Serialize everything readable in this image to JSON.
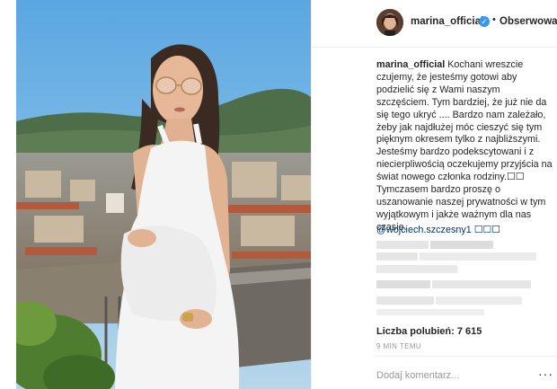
{
  "post": {
    "username": "marina_official",
    "follow_label": "Obserwowanie",
    "caption_user": "marina_official",
    "caption_text": "Kochani wreszcie czujemy, że jesteśmy gotowi aby podzielić się z Wami naszym szczęściem. Tym bardziej, że już nie da się tego ukryć .... Bardzo nam zależało, żeby jak najdłużej móc cieszyć się tym pięknym okresem tylko z najbliższymi. Jesteśmy bardzo podekscytowani i z niecierpliwością oczekujemy przyjścia na świat nowego członka rodziny.☐☐ Tymczasem bardzo proszę o uszanowanie naszej prywatności w tym wyjątkowym i jakże ważnym dla nas czasie.",
    "mention": "@wojciech.szczesny1 ☐☐☐",
    "likes": "Liczba polubień: 7 615",
    "time": "9 MIN TEMU",
    "comment_placeholder": "Dodaj komentarz...",
    "more_label": "···"
  },
  "icons": {
    "verified": "verified-badge-icon",
    "more": "more-options-icon"
  },
  "colors": {
    "verified": "#3897f0",
    "mention": "#003569",
    "muted": "#999999",
    "border": "#efefef"
  }
}
